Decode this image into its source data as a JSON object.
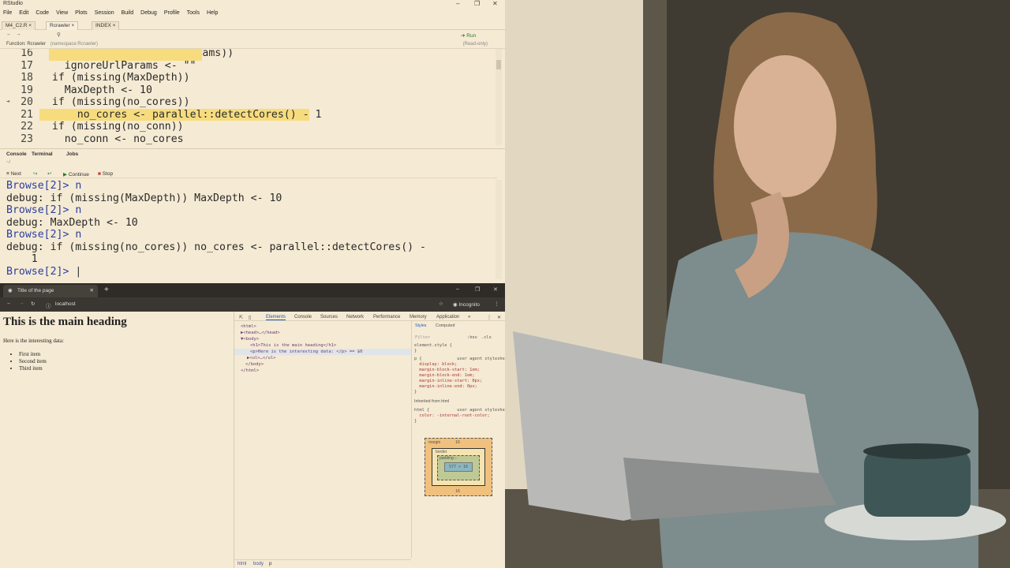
{
  "rstudio": {
    "title": "RStudio",
    "menu": [
      "File",
      "Edit",
      "Code",
      "View",
      "Plots",
      "Session",
      "Build",
      "Debug",
      "Profile",
      "Tools",
      "Help"
    ],
    "tabs": [
      "M4_C2.R",
      "Rcrawler",
      "INDEX"
    ],
    "run_label": "Run",
    "function_label": "Function: Rcrawler",
    "namespace_label": "(namespace:Rcrawler)",
    "readonly_label": "(Read-only)",
    "editor_lines": [
      {
        "n": "16",
        "code": "  if (missing(ignoreUrlParams))"
      },
      {
        "n": "17",
        "code": "    ignoreUrlParams <- \"\""
      },
      {
        "n": "18",
        "code": "  if (missing(MaxDepth))"
      },
      {
        "n": "19",
        "code": "    MaxDepth <- 10"
      },
      {
        "n": "20",
        "code": "  if (missing(no_cores))"
      },
      {
        "n": "21",
        "code": "    no_cores <- parallel::detectCores() - 1"
      },
      {
        "n": "22",
        "code": "  if (missing(no_conn))"
      },
      {
        "n": "23",
        "code": "    no_conn <- no_cores"
      }
    ],
    "console_tabs": [
      "Console",
      "Terminal",
      "Jobs"
    ],
    "console_path": "~/",
    "debug_next": "Next",
    "debug_continue": "Continue",
    "debug_stop": "Stop",
    "console_lines": [
      "Browse[2]> n",
      "debug: if (missing(MaxDepth)) MaxDepth <- 10",
      "Browse[2]> n",
      "debug: MaxDepth <- 10",
      "Browse[2]> n",
      "debug: if (missing(no_cores)) no_cores <- parallel::detectCores() -",
      "    1",
      "Browse[2]> "
    ]
  },
  "chrome": {
    "tab_title": "Title of the page",
    "url": "localhost",
    "incognito_label": "Incognito",
    "page_heading": "This is the main heading",
    "page_paragraph": "Here is the interesting data:",
    "page_items": [
      "First item",
      "Second item",
      "Third item"
    ],
    "devtools_tabs": [
      "Elements",
      "Console",
      "Sources",
      "Network",
      "Performance",
      "Memory",
      "Application"
    ],
    "dom_lines": [
      "<html>",
      "▶<head>…</head>",
      "▼<body>",
      "<h1>This is the main heading</h1>",
      "<p>Here is the interesting data: </p> == $0",
      "▶<ul>…</ul>",
      "</body>",
      "</html>"
    ],
    "styles_tabs": [
      "Styles",
      "Computed"
    ],
    "filter_placeholder": "Filter",
    "hov_label": ":hov",
    "cls_label": ".cls",
    "style_lines": [
      "element.style {",
      "}",
      "p {              user agent stylesheet",
      "  display: block;",
      "  margin-block-start: 1em;",
      "  margin-block-end: 1em;",
      "  margin-inline-start: 0px;",
      "  margin-inline-end: 0px;",
      "}",
      "Inherited from html",
      "html {           user agent stylesheet",
      "  color: -internal-root-color;",
      "}"
    ],
    "box_margin": "margin",
    "box_margin_val": "16",
    "box_border": "border",
    "box_border_val": "–",
    "box_padding": "padding –",
    "box_content": "577 × 16",
    "breadcrumb": [
      "html",
      "body",
      "p"
    ]
  }
}
